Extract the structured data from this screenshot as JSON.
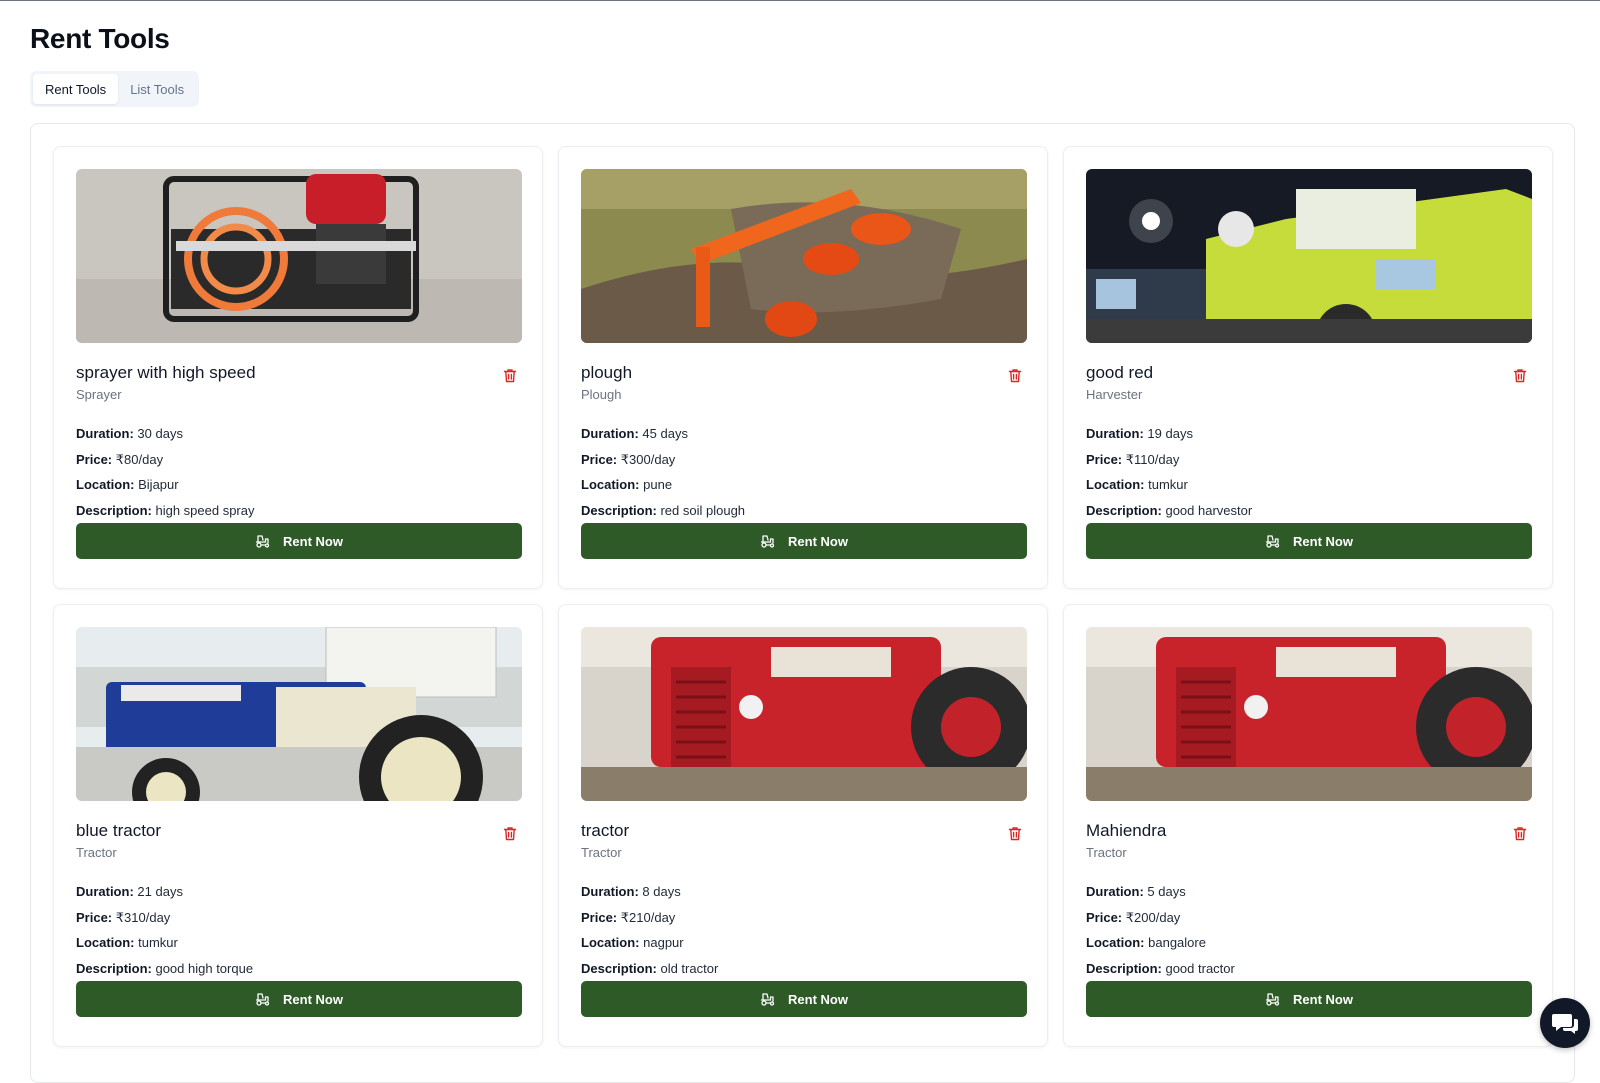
{
  "page": {
    "title": "Rent Tools"
  },
  "tabs": [
    {
      "label": "Rent Tools",
      "active": true
    },
    {
      "label": "List Tools",
      "active": false
    }
  ],
  "labels": {
    "duration": "Duration:",
    "price": "Price:",
    "location": "Location:",
    "description": "Description:",
    "rent_button": "Rent Now"
  },
  "tools": [
    {
      "name": "sprayer with high speed",
      "category": "Sprayer",
      "duration": "30 days",
      "price": "₹80/day",
      "location": "Bijapur",
      "description": "high speed spray",
      "image": "sprayer-photo"
    },
    {
      "name": "plough",
      "category": "Plough",
      "duration": "45 days",
      "price": "₹300/day",
      "location": "pune",
      "description": "red soil plough",
      "image": "plough-photo"
    },
    {
      "name": "good red",
      "category": "Harvester",
      "duration": "19 days",
      "price": "₹110/day",
      "location": "tumkur",
      "description": "good harvestor",
      "image": "harvester-photo"
    },
    {
      "name": "blue tractor",
      "category": "Tractor",
      "duration": "21 days",
      "price": "₹310/day",
      "location": "tumkur",
      "description": "good high torque",
      "image": "blue-tractor-photo"
    },
    {
      "name": "tractor",
      "category": "Tractor",
      "duration": "8 days",
      "price": "₹210/day",
      "location": "nagpur",
      "description": "old tractor",
      "image": "red-tractor-photo"
    },
    {
      "name": "Mahiendra",
      "category": "Tractor",
      "duration": "5 days",
      "price": "₹200/day",
      "location": "bangalore",
      "description": "good tractor",
      "image": "red-tractor-photo"
    }
  ],
  "colors": {
    "primary": "#2d5a27",
    "delete": "#dc2626",
    "muted": "#6b7280"
  },
  "icons": {
    "delete": "trash-icon",
    "rent": "tractor-icon",
    "chat": "chat-icon"
  }
}
